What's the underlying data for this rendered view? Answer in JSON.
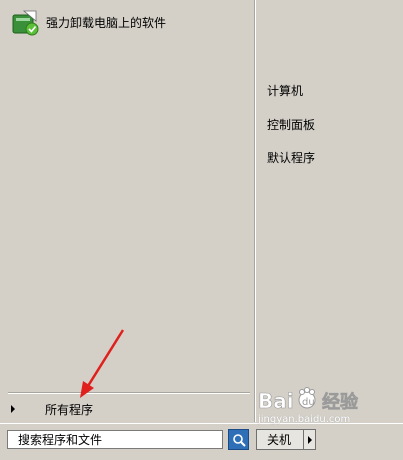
{
  "start_menu": {
    "pinned_program": {
      "label": "强力卸载电脑上的软件",
      "icon": "uninstaller-app-icon"
    },
    "right_items": [
      {
        "label": "计算机"
      },
      {
        "label": "控制面板"
      },
      {
        "label": "默认程序"
      }
    ],
    "all_programs_label": "所有程序"
  },
  "bottom": {
    "search_placeholder": "搜索程序和文件",
    "shutdown_label": "关机"
  },
  "watermark": {
    "brand": "Bai du 经验",
    "url": "jingyan.baidu.com"
  },
  "colors": {
    "menu_background": "#d4d0c8",
    "search_button": "#2f6fb8",
    "annotation_arrow": "#e0201c"
  }
}
